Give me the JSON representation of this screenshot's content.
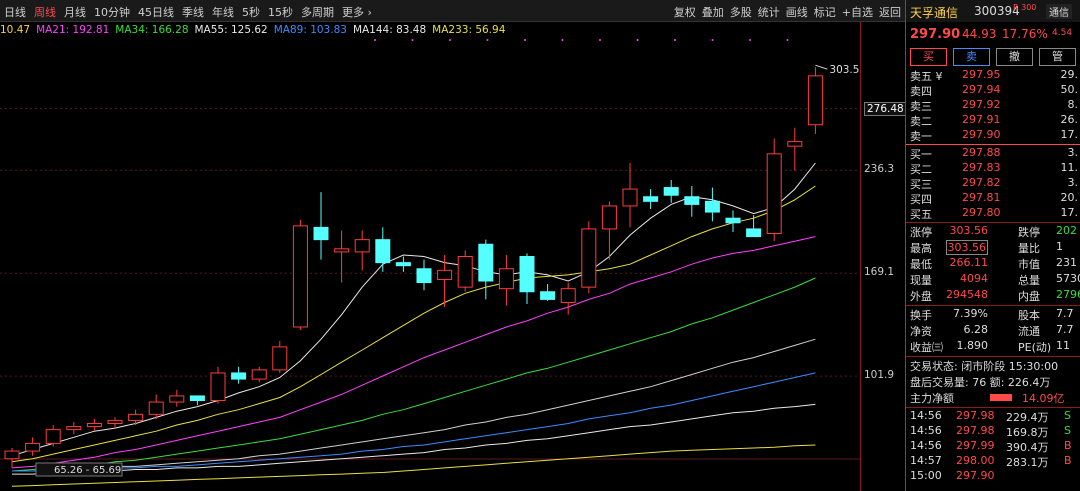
{
  "toolbar": {
    "periods": [
      "日线",
      "周线",
      "月线",
      "10分钟",
      "45日线",
      "季线",
      "年线",
      "5秒",
      "15秒",
      "多周期",
      "更多 ›"
    ],
    "active_period": "周线",
    "tools": [
      "复权",
      "叠加",
      "多股",
      "统计",
      "画线",
      "标记",
      "+自选",
      "返回"
    ]
  },
  "ma_legend": [
    {
      "text": "10.47",
      "color": "#ffd24a"
    },
    {
      "text": "MA21: 192.81",
      "color": "#ff40ff"
    },
    {
      "text": "MA34: 166.28",
      "color": "#3cdc3c"
    },
    {
      "text": "MA55: 125.62",
      "color": "#e8e8e8"
    },
    {
      "text": "MA89: 103.83",
      "color": "#3a8cff"
    },
    {
      "text": "MA144: 83.48",
      "color": "#e8e8e8"
    },
    {
      "text": "MA233: 56.94",
      "color": "#e8e040"
    }
  ],
  "chart_data": {
    "type": "candlestick",
    "y_range": [
      40,
      320
    ],
    "high_label": "303.56",
    "low_range_label": "65.26 - 65.69",
    "candles": [
      {
        "o": 48,
        "h": 55,
        "l": 42,
        "c": 53
      },
      {
        "o": 53,
        "h": 62,
        "l": 50,
        "c": 58
      },
      {
        "o": 58,
        "h": 70,
        "l": 56,
        "c": 67
      },
      {
        "o": 67,
        "h": 72,
        "l": 64,
        "c": 69
      },
      {
        "o": 69,
        "h": 74,
        "l": 66,
        "c": 71
      },
      {
        "o": 71,
        "h": 75,
        "l": 68,
        "c": 73
      },
      {
        "o": 73,
        "h": 80,
        "l": 70,
        "c": 77
      },
      {
        "o": 77,
        "h": 90,
        "l": 74,
        "c": 85
      },
      {
        "o": 85,
        "h": 93,
        "l": 82,
        "c": 89
      },
      {
        "o": 89,
        "h": 87,
        "l": 83,
        "c": 86
      },
      {
        "o": 86,
        "h": 108,
        "l": 84,
        "c": 104
      },
      {
        "o": 104,
        "h": 108,
        "l": 97,
        "c": 100
      },
      {
        "o": 100,
        "h": 108,
        "l": 98,
        "c": 106
      },
      {
        "o": 106,
        "h": 125,
        "l": 104,
        "c": 121
      },
      {
        "o": 134,
        "h": 204,
        "l": 132,
        "c": 200
      },
      {
        "o": 199,
        "h": 222,
        "l": 178,
        "c": 191
      },
      {
        "o": 183,
        "h": 197,
        "l": 163,
        "c": 185
      },
      {
        "o": 183,
        "h": 197,
        "l": 171,
        "c": 191
      },
      {
        "o": 191,
        "h": 199,
        "l": 170,
        "c": 176
      },
      {
        "o": 176,
        "h": 180,
        "l": 170,
        "c": 174
      },
      {
        "o": 172,
        "h": 178,
        "l": 158,
        "c": 163
      },
      {
        "o": 165,
        "h": 181,
        "l": 147,
        "c": 171
      },
      {
        "o": 160,
        "h": 184,
        "l": 157,
        "c": 180
      },
      {
        "o": 188,
        "h": 191,
        "l": 152,
        "c": 164
      },
      {
        "o": 159,
        "h": 181,
        "l": 148,
        "c": 172
      },
      {
        "o": 180,
        "h": 182,
        "l": 149,
        "c": 157
      },
      {
        "o": 157,
        "h": 162,
        "l": 151,
        "c": 152
      },
      {
        "o": 150,
        "h": 163,
        "l": 142,
        "c": 159
      },
      {
        "o": 160,
        "h": 203,
        "l": 156,
        "c": 198
      },
      {
        "o": 198,
        "h": 216,
        "l": 178,
        "c": 213
      },
      {
        "o": 213,
        "h": 241,
        "l": 199,
        "c": 224
      },
      {
        "o": 219,
        "h": 224,
        "l": 211,
        "c": 216
      },
      {
        "o": 225,
        "h": 230,
        "l": 215,
        "c": 220
      },
      {
        "o": 219,
        "h": 226,
        "l": 206,
        "c": 214
      },
      {
        "o": 216,
        "h": 225,
        "l": 203,
        "c": 209
      },
      {
        "o": 205,
        "h": 210,
        "l": 196,
        "c": 202
      },
      {
        "o": 198,
        "h": 207,
        "l": 193,
        "c": 193
      },
      {
        "o": 195,
        "h": 257,
        "l": 190,
        "c": 247
      },
      {
        "o": 252,
        "h": 264,
        "l": 236,
        "c": 255
      },
      {
        "o": 266,
        "h": 303.56,
        "l": 260,
        "c": 297.9
      }
    ],
    "ma_lines": [
      {
        "name": "MA5",
        "color": "#e8e8e8",
        "values": [
          50,
          54,
          58,
          62,
          66,
          68,
          71,
          75,
          79,
          82,
          86,
          91,
          95,
          101,
          112,
          126,
          142,
          160,
          175,
          181,
          180,
          176,
          174,
          170,
          168,
          170,
          168,
          164,
          170,
          180,
          194,
          205,
          214,
          219,
          217,
          213,
          208,
          212,
          224,
          241
        ]
      },
      {
        "name": "MA10",
        "color": "#e8e040",
        "values": [
          46,
          48,
          51,
          54,
          57,
          60,
          63,
          66,
          70,
          73,
          77,
          80,
          84,
          88,
          95,
          103,
          111,
          119,
          127,
          135,
          143,
          150,
          156,
          160,
          163,
          166,
          167,
          168,
          170,
          172,
          175,
          181,
          187,
          193,
          198,
          202,
          205,
          210,
          217,
          226
        ]
      },
      {
        "name": "MA21",
        "color": "#ff40ff",
        "values": [
          42,
          43,
          45,
          47,
          49,
          52,
          54,
          57,
          60,
          63,
          66,
          69,
          72,
          75,
          80,
          85,
          90,
          96,
          102,
          108,
          114,
          119,
          124,
          129,
          134,
          138,
          143,
          147,
          152,
          156,
          162,
          166,
          170,
          175,
          179,
          182,
          184,
          187,
          190,
          193
        ]
      },
      {
        "name": "MA34",
        "color": "#3cdc3c",
        "values": [
          40,
          41,
          42,
          43,
          44,
          46,
          47,
          49,
          51,
          53,
          55,
          57,
          59,
          61,
          64,
          67,
          70,
          73,
          77,
          80,
          84,
          88,
          92,
          96,
          100,
          104,
          107,
          111,
          115,
          119,
          123,
          127,
          131,
          136,
          140,
          145,
          150,
          155,
          160,
          166
        ]
      },
      {
        "name": "MA55",
        "color": "#cfcfcf",
        "values": [
          40,
          40,
          41,
          41,
          42,
          43,
          43,
          44,
          45,
          46,
          47,
          48,
          50,
          51,
          53,
          55,
          57,
          59,
          61,
          63,
          65,
          67,
          70,
          72,
          75,
          77,
          80,
          83,
          86,
          89,
          92,
          95,
          99,
          103,
          107,
          111,
          114,
          118,
          122,
          126
        ]
      },
      {
        "name": "MA89",
        "color": "#3a8cff",
        "values": [
          40,
          40,
          40,
          41,
          41,
          42,
          42,
          43,
          43,
          44,
          45,
          46,
          47,
          48,
          49,
          50,
          51,
          53,
          54,
          56,
          57,
          59,
          61,
          63,
          65,
          67,
          69,
          71,
          74,
          76,
          78,
          81,
          83,
          86,
          89,
          92,
          95,
          98,
          101,
          104
        ]
      },
      {
        "name": "MA144",
        "color": "#e8e8e8",
        "values": [
          38,
          38,
          39,
          39,
          40,
          40,
          41,
          41,
          42,
          42,
          43,
          43,
          44,
          45,
          46,
          47,
          48,
          49,
          50,
          51,
          52,
          54,
          55,
          57,
          58,
          60,
          61,
          63,
          65,
          67,
          69,
          70,
          72,
          74,
          76,
          78,
          79,
          81,
          82,
          83.5
        ]
      },
      {
        "name": "MA233",
        "color": "#e8e040",
        "values": [
          30,
          30.5,
          31,
          31.5,
          32,
          32.5,
          33,
          33.5,
          34,
          34.5,
          35,
          35.5,
          36,
          36.5,
          37,
          37.5,
          38,
          38.5,
          39,
          40,
          41,
          42,
          43,
          44,
          45,
          46,
          47,
          48,
          49,
          50,
          51,
          52,
          53,
          53.5,
          54,
          54.5,
          55,
          55.5,
          56.5,
          57
        ]
      }
    ]
  },
  "price_axis": [
    {
      "label": "276.48",
      "value": 276.48,
      "boxed": true
    },
    {
      "label": "236.3",
      "value": 236.3,
      "boxed": false
    },
    {
      "label": "169.1",
      "value": 169.1,
      "boxed": false
    },
    {
      "label": "101.9",
      "value": 101.9,
      "boxed": false
    }
  ],
  "stock": {
    "name": "天孚通信",
    "code": "300394",
    "badge": "R 300",
    "top_btn": "通信",
    "top_btn_sub": "4.54",
    "price": "297.90",
    "change": "44.93",
    "change_pct": "17.76%"
  },
  "trade_buttons": [
    "买",
    "卖",
    "撤",
    "管"
  ],
  "sell_book": [
    {
      "label": "卖五 ¥",
      "price": "297.95",
      "vol": "29."
    },
    {
      "label": "卖四",
      "price": "297.94",
      "vol": "50."
    },
    {
      "label": "卖三",
      "price": "297.92",
      "vol": "8."
    },
    {
      "label": "卖二",
      "price": "297.91",
      "vol": "26."
    },
    {
      "label": "卖一",
      "price": "297.90",
      "vol": "17."
    }
  ],
  "buy_book": [
    {
      "label": "买一",
      "price": "297.88",
      "vol": "3."
    },
    {
      "label": "买二",
      "price": "297.83",
      "vol": "11."
    },
    {
      "label": "买三",
      "price": "297.82",
      "vol": "3."
    },
    {
      "label": "买四",
      "price": "297.81",
      "vol": "20."
    },
    {
      "label": "买五",
      "price": "297.80",
      "vol": "17."
    }
  ],
  "stats": [
    {
      "k1": "涨停",
      "v1": "303.56",
      "k2": "跌停",
      "v2": "202",
      "c1": "#ff4a4a",
      "c2": "#3cdc3c"
    },
    {
      "k1": "最高",
      "v1": "303.56",
      "k2": "量比",
      "v2": "1",
      "c1": "#ff4a4a",
      "c2": "#ddd",
      "boxed": true
    },
    {
      "k1": "最低",
      "v1": "266.11",
      "k2": "市值",
      "v2": "231",
      "c1": "#ff4a4a",
      "c2": "#ddd"
    },
    {
      "k1": "现量",
      "v1": "4094",
      "k2": "总量",
      "v2": "5730",
      "c1": "#ff4a4a",
      "c2": "#ddd"
    },
    {
      "k1": "外盘",
      "v1": "294548",
      "k2": "内盘",
      "v2": "2796",
      "c1": "#ff4a4a",
      "c2": "#3cdc3c"
    }
  ],
  "stats2": [
    {
      "k1": "换手",
      "v1": "7.39%",
      "k2": "股本",
      "v2": "7.7"
    },
    {
      "k1": "净资",
      "v1": "6.28",
      "k2": "流通",
      "v2": "7.7"
    },
    {
      "k1": "收益㈢",
      "v1": "1.890",
      "k2": "PE(动)",
      "v2": "11"
    }
  ],
  "status": {
    "line1": "交易状态: 闭市阶段 15:30:00",
    "line2": "盘后交易量: 76  额: 226.4万",
    "net_label": "主力净额",
    "net_value": "14.09亿"
  },
  "trades": [
    {
      "time": "14:56",
      "price": "297.98",
      "vol": "229.4万",
      "side": "S"
    },
    {
      "time": "14:56",
      "price": "297.98",
      "vol": "169.8万",
      "side": "S"
    },
    {
      "time": "14:56",
      "price": "297.99",
      "vol": "390.4万",
      "side": "B"
    },
    {
      "time": "14:57",
      "price": "298.00",
      "vol": "283.1万",
      "side": "B"
    },
    {
      "time": "15:00",
      "price": "297.90",
      "vol": "",
      "side": ""
    }
  ]
}
